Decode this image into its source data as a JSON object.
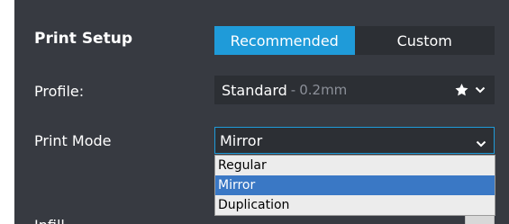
{
  "panel": {
    "title": "Print Setup",
    "tabs": [
      {
        "label": "Recommended",
        "active": true
      },
      {
        "label": "Custom",
        "active": false
      }
    ]
  },
  "profile": {
    "label": "Profile:",
    "name": "Standard",
    "separator": "-",
    "detail": "0.2mm",
    "icons": [
      "star-icon",
      "chevron-down-icon"
    ]
  },
  "print_mode": {
    "label": "Print Mode",
    "value": "Mirror",
    "options": [
      "Regular",
      "Mirror",
      "Duplication"
    ],
    "selected": "Mirror"
  },
  "infill": {
    "label": "Infill"
  },
  "colors": {
    "panel_bg": "#373a41",
    "control_bg": "#2c2f34",
    "accent": "#1f9bd9",
    "dropdown_bg": "#ececec",
    "selected_option": "#3a78c5"
  }
}
